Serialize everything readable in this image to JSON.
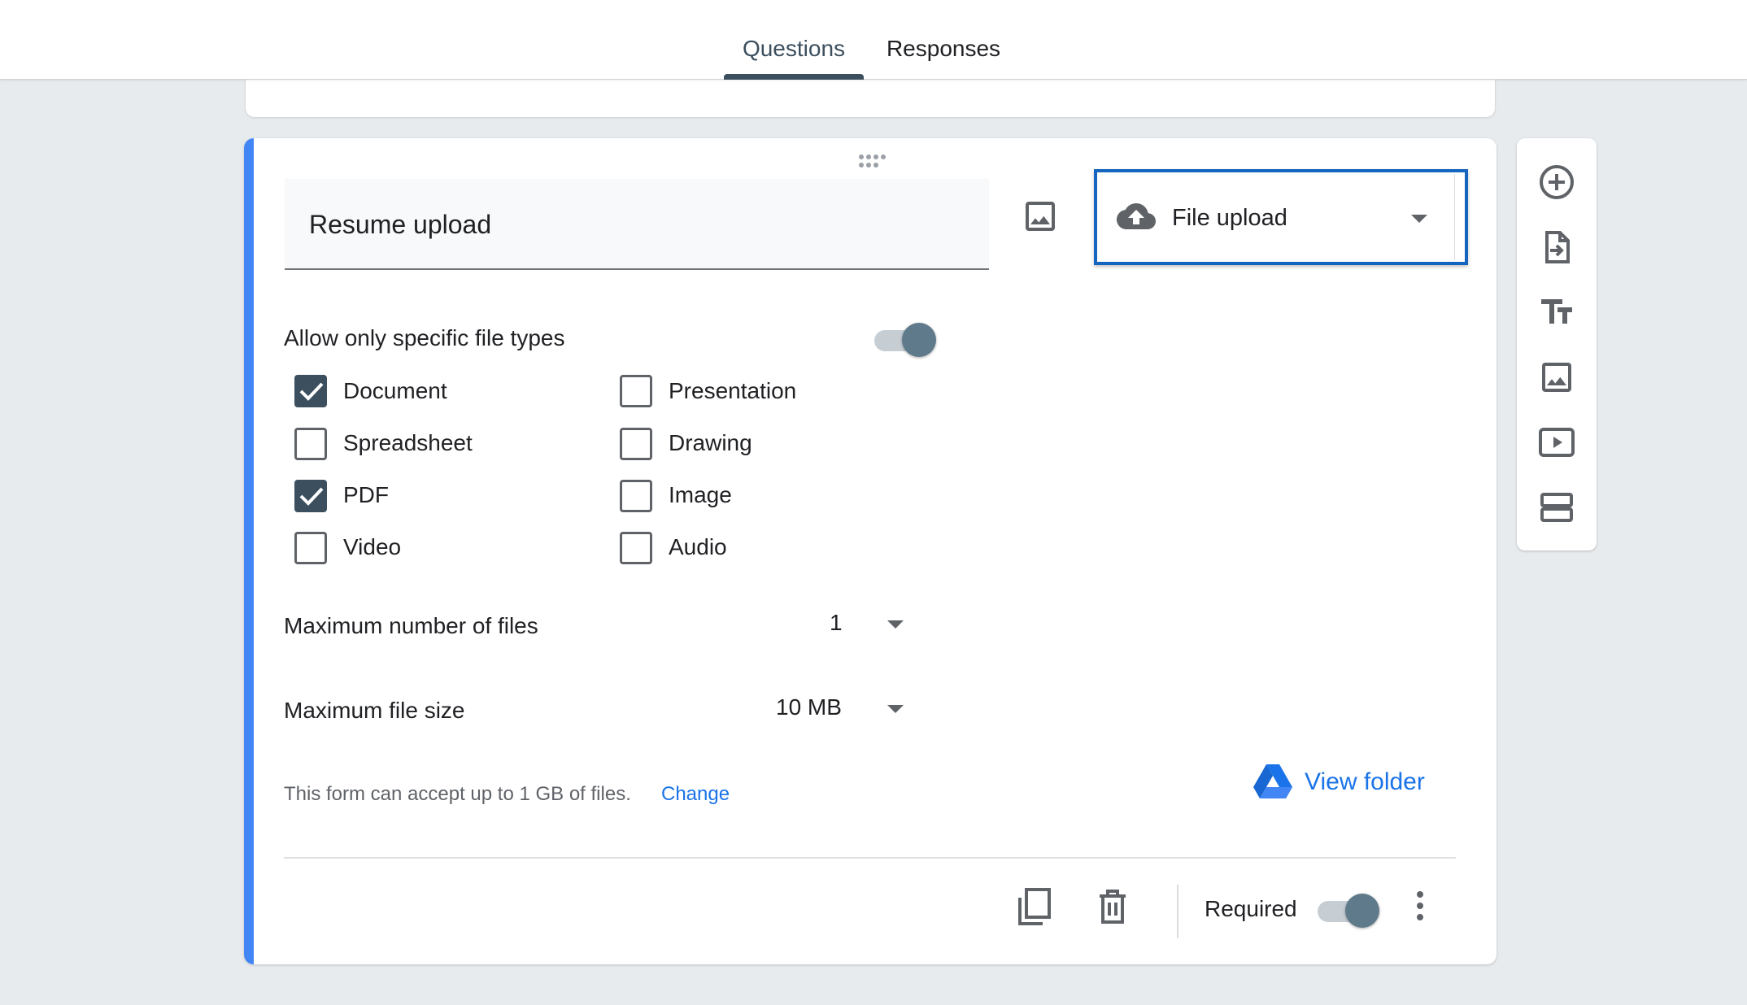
{
  "tabs": [
    {
      "label": "Questions",
      "active": true
    },
    {
      "label": "Responses",
      "active": false
    }
  ],
  "question": {
    "title": "Resume upload",
    "type_label": "File upload",
    "allow_specific_label": "Allow only specific file types",
    "allow_specific_on": true,
    "file_types": [
      {
        "label": "Document",
        "checked": true
      },
      {
        "label": "Spreadsheet",
        "checked": false
      },
      {
        "label": "PDF",
        "checked": true
      },
      {
        "label": "Video",
        "checked": false
      },
      {
        "label": "Presentation",
        "checked": false
      },
      {
        "label": "Drawing",
        "checked": false
      },
      {
        "label": "Image",
        "checked": false
      },
      {
        "label": "Audio",
        "checked": false
      }
    ],
    "max_files_label": "Maximum number of files",
    "max_files_value": "1",
    "max_size_label": "Maximum file size",
    "max_size_value": "10 MB",
    "info_text": "This form can accept up to 1 GB of files.",
    "change_label": "Change",
    "view_folder_label": "View folder",
    "required_label": "Required",
    "required_on": true
  },
  "colors": {
    "accent": "#4285f4",
    "link": "#1a73e8",
    "checked": "#3c4f5e",
    "select_highlight": "#1565c0"
  },
  "side_toolbar": [
    {
      "icon": "add-question-icon"
    },
    {
      "icon": "import-questions-icon"
    },
    {
      "icon": "add-title-icon"
    },
    {
      "icon": "add-image-icon"
    },
    {
      "icon": "add-video-icon"
    },
    {
      "icon": "add-section-icon"
    }
  ]
}
